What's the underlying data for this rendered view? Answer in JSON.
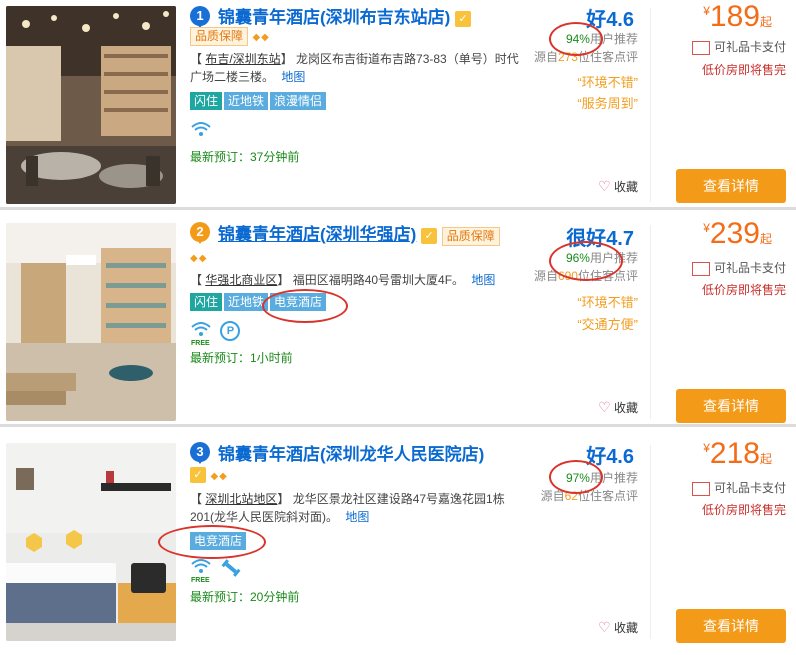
{
  "hotels": [
    {
      "rank": "1",
      "rank_color": "#1a6fd6",
      "name": "锦囊青年酒店(深圳布吉东站店)",
      "quality_badge": "品质保障",
      "area": "布吉/深圳东站",
      "address": "龙岗区布吉街道布吉路73-83（单号）时代广场二楼三楼。",
      "map_label": "地图",
      "tags": [
        "闪住",
        "近地铁",
        "浪漫情侣"
      ],
      "facilities": [
        "wifi-icon"
      ],
      "latest": "最新预订：37分钟前",
      "score_word": "好",
      "score": "4.6",
      "recommend_pct": "94%",
      "recommend_text": "用户推荐",
      "source_prefix": "源自",
      "review_count": "273",
      "source_suffix": "位住客点评",
      "quotes": [
        "“环境不错”",
        "“服务周到”"
      ],
      "favorite": "收藏",
      "currency": "¥",
      "price": "189",
      "price_unit": "起",
      "gift_card": "可礼品卡支付",
      "low_price": "低价房即将售完",
      "button": "查看详情"
    },
    {
      "rank": "2",
      "rank_color": "#f39b18",
      "name": "锦囊青年酒店(深圳华强店)",
      "quality_badge": "品质保障",
      "area": "华强北商业区",
      "address": "福田区福明路40号雷圳大厦4F。",
      "map_label": "地图",
      "tags": [
        "闪住",
        "近地铁",
        "电竞酒店"
      ],
      "facilities": [
        "wifi-free-icon",
        "parking-icon"
      ],
      "free_label": "FREE",
      "parking_letter": "P",
      "latest": "最新预订：1小时前",
      "score_word": "很好",
      "score": "4.7",
      "recommend_pct": "96%",
      "recommend_text": "用户推荐",
      "source_prefix": "源自",
      "review_count": "690",
      "source_suffix": "位住客点评",
      "quotes": [
        "“环境不错”",
        "“交通方便”"
      ],
      "favorite": "收藏",
      "currency": "¥",
      "price": "239",
      "price_unit": "起",
      "gift_card": "可礼品卡支付",
      "low_price": "低价房即将售完",
      "button": "查看详情"
    },
    {
      "rank": "3",
      "rank_color": "#1a6fd6",
      "name": "锦囊青年酒店(深圳龙华人民医院店)",
      "area": "深圳北站地区",
      "address": "龙华区景龙社区建设路47号嘉逸花园1栋201(龙华人民医院斜对面)。",
      "map_label": "地图",
      "tags": [
        "电竞酒店"
      ],
      "facilities": [
        "wifi-free-icon",
        "gym-icon"
      ],
      "free_label": "FREE",
      "latest": "最新预订：20分钟前",
      "score_word": "好",
      "score": "4.6",
      "recommend_pct": "97%",
      "recommend_text": "用户推荐",
      "source_prefix": "源自",
      "review_count": "62",
      "source_suffix": "位住客点评",
      "favorite": "收藏",
      "currency": "¥",
      "price": "218",
      "price_unit": "起",
      "gift_card": "可礼品卡支付",
      "low_price": "低价房即将售完",
      "button": "查看详情"
    }
  ]
}
